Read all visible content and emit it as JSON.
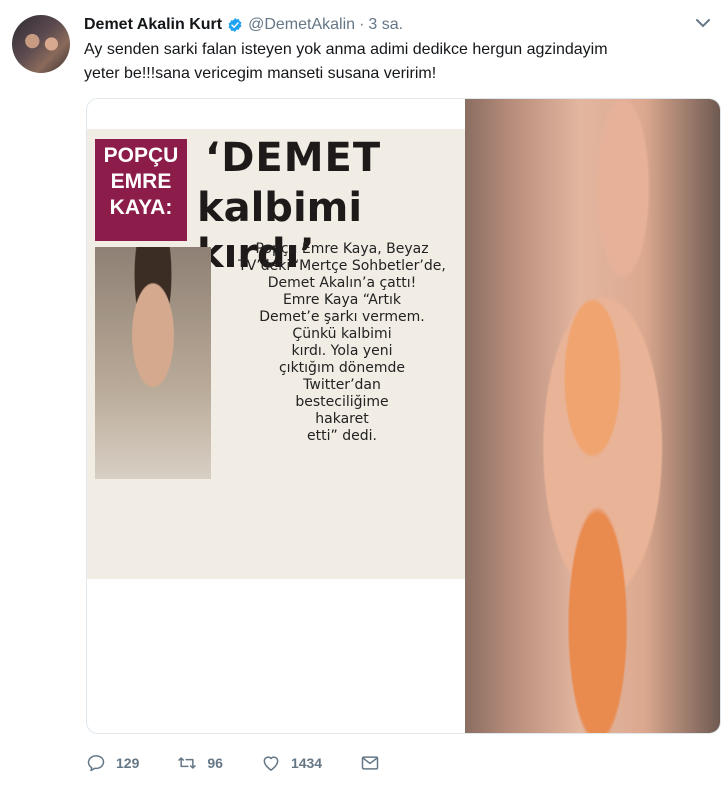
{
  "tweet": {
    "author_name": "Demet Akalin Kurt",
    "handle": "@DemetAkalin",
    "separator": "·",
    "time": "3 sa.",
    "text_line1": "Ay senden sarki falan isteyen yok anma adimi dedikce hergun agzindayim",
    "text_line2": "yeter be!!!sana vericegim manseti susana veririm!"
  },
  "clipping": {
    "kicker_line1": "POPÇU",
    "kicker_line2": "EMRE",
    "kicker_line3": "KAYA:",
    "headline_line1": "‘DEMET",
    "headline_line2": "kalbimi kırdı’",
    "body_lines": [
      "Popçu Emre Kaya, Beyaz",
      "TV’deki ‘Mertçe Sohbetler’de,",
      "Demet Akalın’a çattı!",
      "Emre Kaya “Artık",
      "Demet’e şarkı vermem.",
      "Çünkü kalbimi",
      "kırdı. Yola yeni",
      "çıktığım dönemde",
      "Twitter’dan",
      "besteciliğime",
      "hakaret",
      "etti” dedi."
    ]
  },
  "actions": {
    "replies": "129",
    "retweets": "96",
    "likes": "1434"
  },
  "colors": {
    "text": "#14171a",
    "muted": "#657786",
    "verified": "#1da1f2",
    "kicker_bg": "#8c1d4a"
  },
  "icons": [
    "verified-badge-icon",
    "chevron-down-icon",
    "reply-icon",
    "retweet-icon",
    "like-icon",
    "message-icon"
  ]
}
